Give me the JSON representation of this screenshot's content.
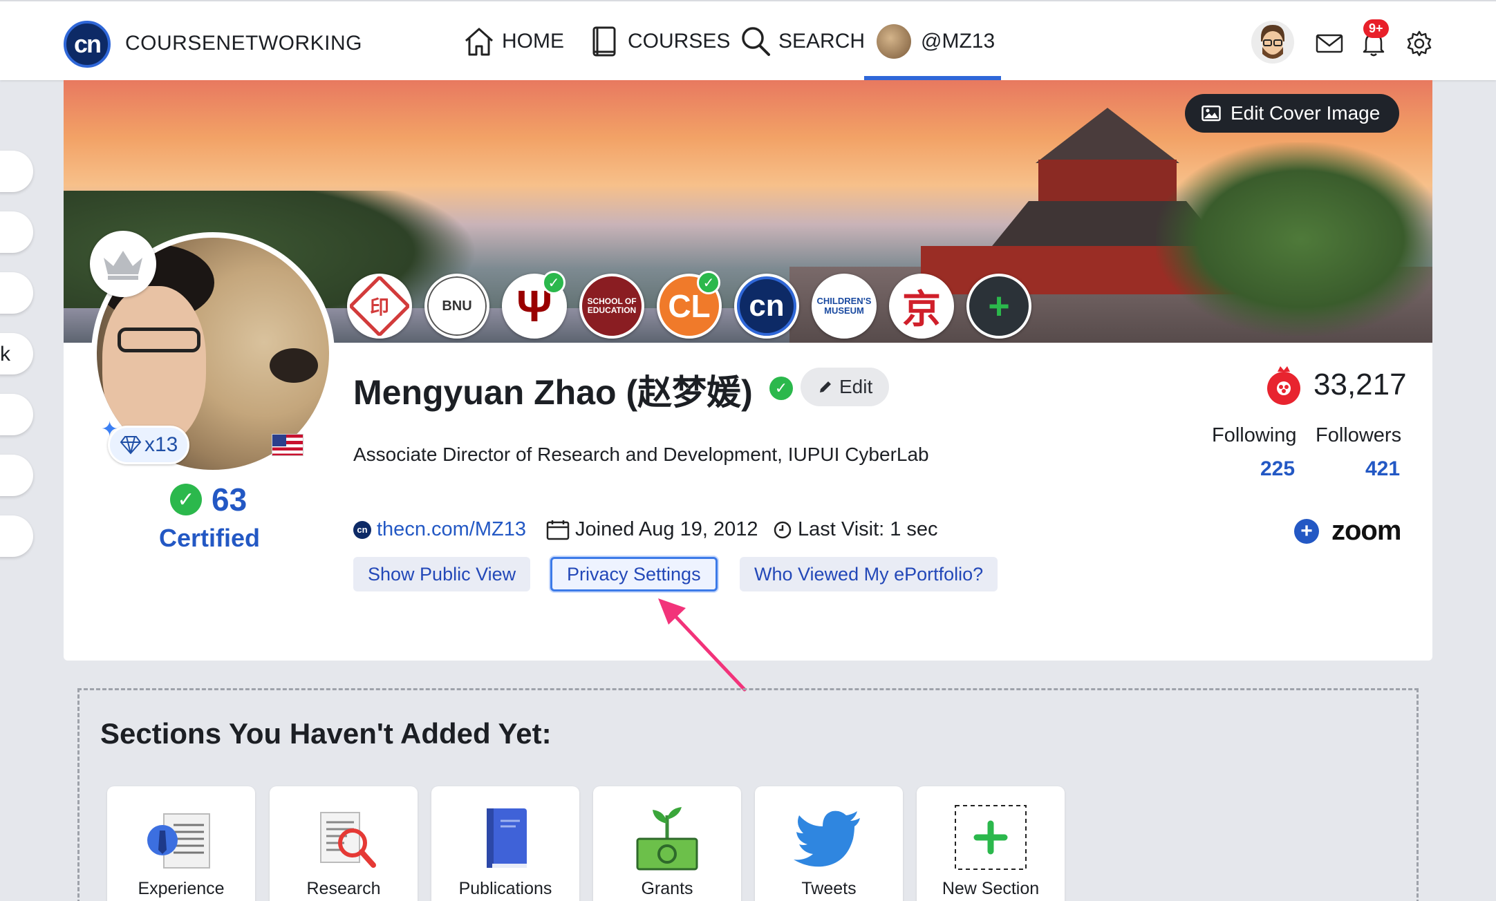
{
  "nav": {
    "brand": "COURSENETWORKING",
    "logo_text": "cn",
    "items": [
      {
        "label": "HOME",
        "icon": "home-icon"
      },
      {
        "label": "COURSES",
        "icon": "book-icon"
      },
      {
        "label": "SEARCH",
        "icon": "search-icon"
      },
      {
        "label": "@MZ13",
        "icon": "avatar"
      }
    ],
    "active_item": "@MZ13",
    "notification_badge": "9+"
  },
  "cover": {
    "edit_label": "Edit Cover Image"
  },
  "badges": [
    {
      "name": "chinese-seal-badge",
      "text": "印"
    },
    {
      "name": "beijing-normal-university-badge",
      "text": "BNU"
    },
    {
      "name": "indiana-university-badge",
      "text": "Ψ",
      "checked": true
    },
    {
      "name": "school-of-education-badge",
      "text": "SCHOOL OF EDUCATION"
    },
    {
      "name": "cl-badge",
      "text": "CL",
      "checked": true
    },
    {
      "name": "cn-badge",
      "text": "cn"
    },
    {
      "name": "childrens-museum-badge",
      "text": "CHILDREN'S MUSEUM"
    },
    {
      "name": "beijing-olympics-badge",
      "text": "京"
    },
    {
      "name": "add-badge",
      "text": "+"
    }
  ],
  "profile": {
    "name": "Mengyuan Zhao (赵梦媛)",
    "edit_label": "Edit",
    "title": "Associate Director of Research and Development, IUPUI CyberLab",
    "gems": "x13",
    "certified_count": "63",
    "certified_label": "Certified",
    "url": "thecn.com/MZ13",
    "joined": "Joined Aug 19, 2012",
    "last_visit": "Last Visit: 1 sec"
  },
  "actions": {
    "public_view": "Show Public View",
    "privacy": "Privacy Settings",
    "who_viewed": "Who Viewed My ePortfolio?"
  },
  "stats": {
    "points": "33,217",
    "following_label": "Following",
    "following": "225",
    "followers_label": "Followers",
    "followers": "421",
    "zoom": "zoom"
  },
  "left_tab_letter": "k",
  "sections": {
    "title": "Sections You Haven't Added Yet:",
    "items": [
      {
        "label": "Experience",
        "icon": "experience-icon"
      },
      {
        "label": "Research",
        "icon": "research-icon"
      },
      {
        "label": "Publications",
        "icon": "publications-icon"
      },
      {
        "label": "Grants",
        "icon": "grants-icon"
      },
      {
        "label": "Tweets",
        "icon": "twitter-icon"
      },
      {
        "label": "New Section",
        "icon": "plus-icon"
      }
    ]
  },
  "colors": {
    "accent": "#2358c4",
    "success": "#2bb84c",
    "alert": "#e8202a"
  }
}
